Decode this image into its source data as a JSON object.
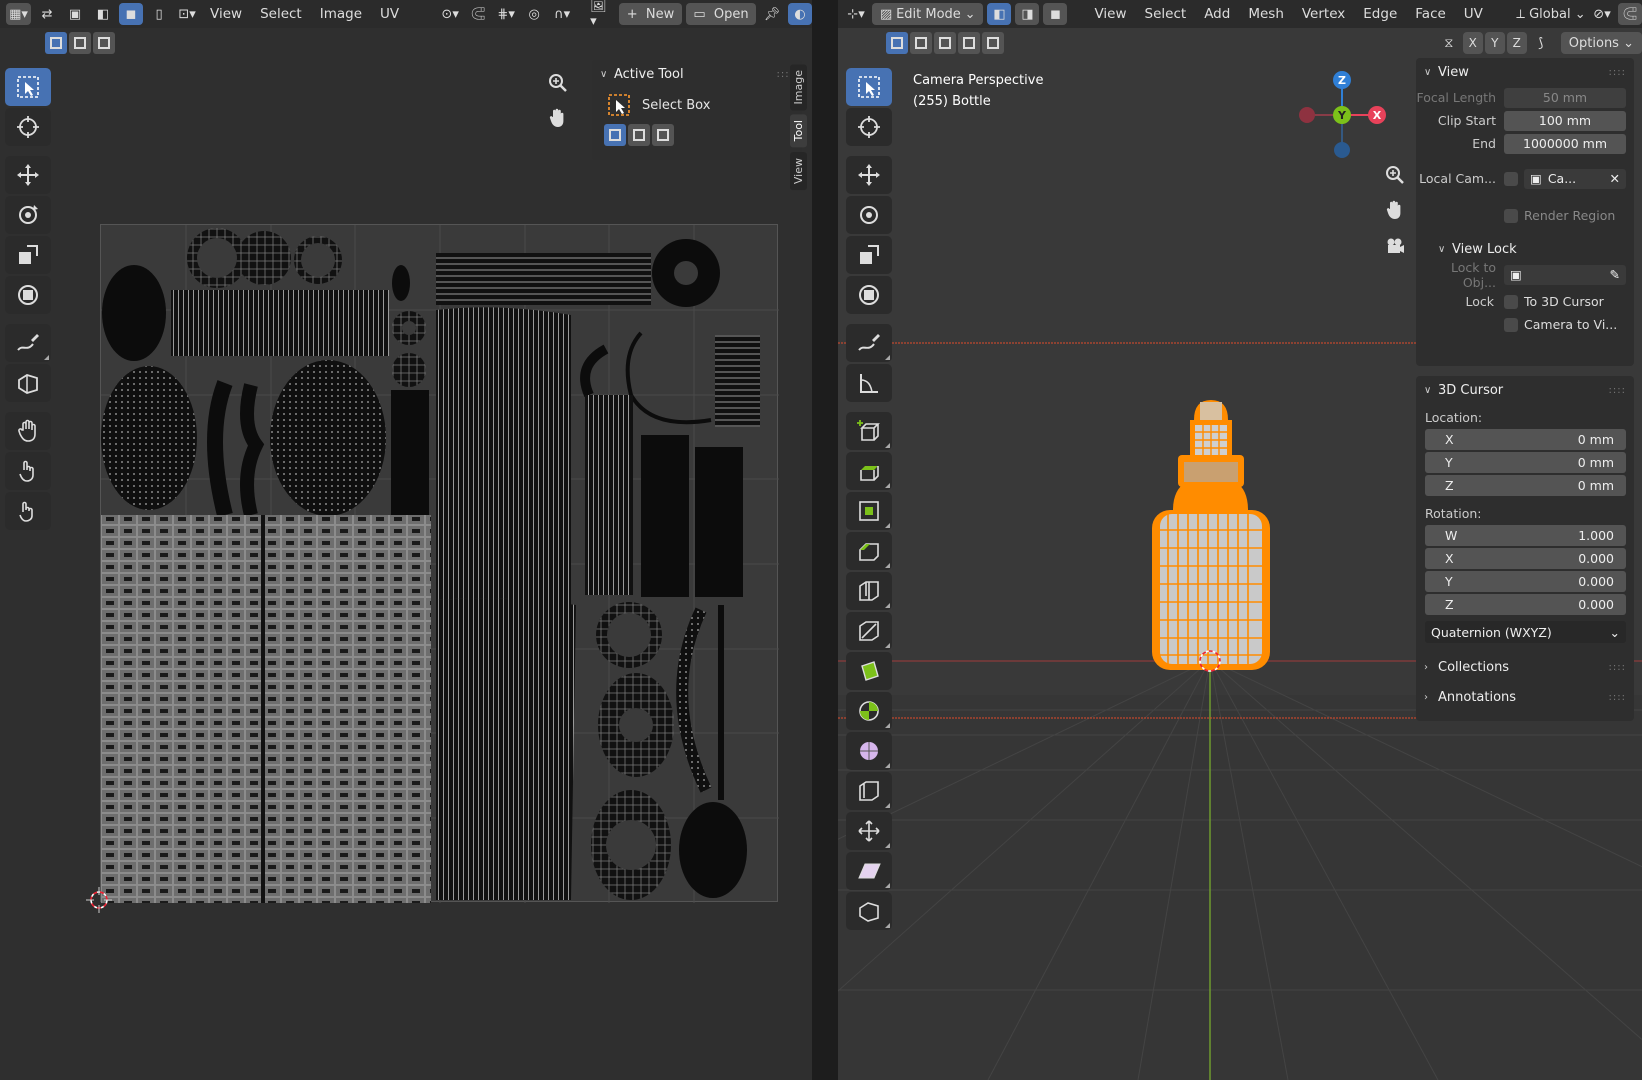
{
  "uv_editor": {
    "header": {
      "menus": [
        "View",
        "Select",
        "Image",
        "UV"
      ],
      "new_label": "New",
      "open_label": "Open"
    },
    "side_tabs": [
      "Image",
      "Tool",
      "View"
    ],
    "active_tool": {
      "title": "Active Tool",
      "tool_name": "Select Box"
    }
  },
  "viewport": {
    "header": {
      "mode": "Edit Mode",
      "menus": [
        "View",
        "Select",
        "Add",
        "Mesh",
        "Vertex",
        "Edge",
        "Face",
        "UV"
      ],
      "orientation": "Global",
      "axes": [
        "X",
        "Y",
        "Z"
      ],
      "options_label": "Options"
    },
    "info": {
      "line1": "Camera Perspective",
      "line2": "(255) Bottle"
    },
    "gizmo": {
      "z": "Z",
      "y": "Y",
      "x": "X"
    },
    "npanel": {
      "view": {
        "title": "View",
        "focal_length_label": "Focal Length",
        "focal_length": "50 mm",
        "clip_start_label": "Clip Start",
        "clip_start": "100 mm",
        "end_label": "End",
        "end": "1000000 mm",
        "local_cam_label": "Local Cam...",
        "local_cam_value": "Ca...",
        "render_region_label": "Render Region"
      },
      "view_lock": {
        "title": "View Lock",
        "lock_to_obj_label": "Lock to Obj...",
        "lock_label": "Lock",
        "to_3d_cursor": "To 3D Cursor",
        "camera_to_view": "Camera to Vi..."
      },
      "cursor": {
        "title": "3D Cursor",
        "location_label": "Location:",
        "x_label": "X",
        "x": "0 mm",
        "y_label": "Y",
        "y": "0 mm",
        "z_label": "Z",
        "z": "0 mm",
        "rotation_label": "Rotation:",
        "rw_label": "W",
        "rw": "1.000",
        "rx_label": "X",
        "rx": "0.000",
        "ry_label": "Y",
        "ry": "0.000",
        "rz_label": "Z",
        "rz": "0.000",
        "mode": "Quaternion (WXYZ)"
      },
      "collections_title": "Collections",
      "annotations_title": "Annotations"
    }
  },
  "colors": {
    "accent": "#4772b3",
    "selection_orange": "#ff8c00",
    "axis_x": "#e8425a",
    "axis_y": "#7cc11a",
    "axis_z": "#2f7fd6"
  }
}
